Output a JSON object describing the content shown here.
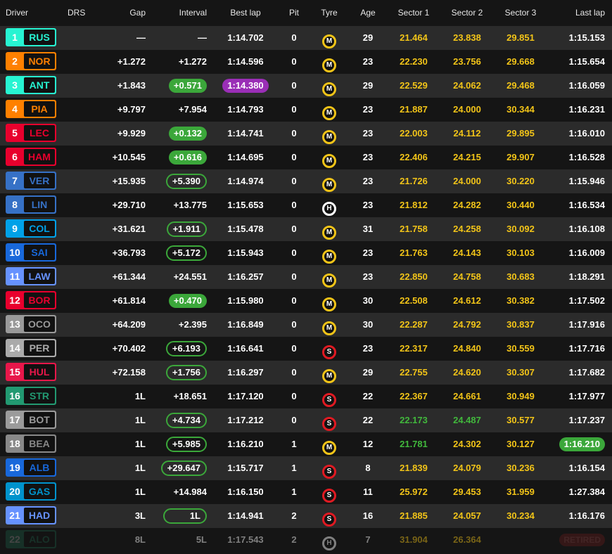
{
  "header": {
    "driver": "Driver",
    "drs": "DRS",
    "gap": "Gap",
    "interval": "Interval",
    "best": "Best lap",
    "pit": "Pit",
    "tyre": "Tyre",
    "age": "Age",
    "s1": "Sector 1",
    "s2": "Sector 2",
    "s3": "Sector 3",
    "last": "Last lap"
  },
  "rows": [
    {
      "pos": "1",
      "abbr": "RUS",
      "color": "#27f4d2",
      "gap": "—",
      "int": "—",
      "int_style": "plain",
      "best": "1:14.702",
      "best_style": "plain",
      "pit": "0",
      "tyre": "M",
      "age": "29",
      "s1": "21.464",
      "s1c": "yellow",
      "s2": "23.838",
      "s2c": "yellow",
      "s3": "29.851",
      "s3c": "yellow",
      "last": "1:15.153",
      "last_style": "plain"
    },
    {
      "pos": "2",
      "abbr": "NOR",
      "color": "#ff8000",
      "gap": "+1.272",
      "int": "+1.272",
      "int_style": "plain",
      "best": "1:14.596",
      "best_style": "plain",
      "pit": "0",
      "tyre": "M",
      "age": "23",
      "s1": "22.230",
      "s1c": "yellow",
      "s2": "23.756",
      "s2c": "yellow",
      "s3": "29.668",
      "s3c": "yellow",
      "last": "1:15.654",
      "last_style": "plain"
    },
    {
      "pos": "3",
      "abbr": "ANT",
      "color": "#27f4d2",
      "gap": "+1.843",
      "int": "+0.571",
      "int_style": "fill",
      "best": "1:14.380",
      "best_style": "purple",
      "pit": "0",
      "tyre": "M",
      "age": "29",
      "s1": "22.529",
      "s1c": "yellow",
      "s2": "24.062",
      "s2c": "yellow",
      "s3": "29.468",
      "s3c": "yellow",
      "last": "1:16.059",
      "last_style": "plain"
    },
    {
      "pos": "4",
      "abbr": "PIA",
      "color": "#ff8000",
      "gap": "+9.797",
      "int": "+7.954",
      "int_style": "plain",
      "best": "1:14.793",
      "best_style": "plain",
      "pit": "0",
      "tyre": "M",
      "age": "23",
      "s1": "21.887",
      "s1c": "yellow",
      "s2": "24.000",
      "s2c": "yellow",
      "s3": "30.344",
      "s3c": "yellow",
      "last": "1:16.231",
      "last_style": "plain"
    },
    {
      "pos": "5",
      "abbr": "LEC",
      "color": "#e8002d",
      "gap": "+9.929",
      "int": "+0.132",
      "int_style": "fill",
      "best": "1:14.741",
      "best_style": "plain",
      "pit": "0",
      "tyre": "M",
      "age": "23",
      "s1": "22.003",
      "s1c": "yellow",
      "s2": "24.112",
      "s2c": "yellow",
      "s3": "29.895",
      "s3c": "yellow",
      "last": "1:16.010",
      "last_style": "plain"
    },
    {
      "pos": "6",
      "abbr": "HAM",
      "color": "#e8002d",
      "gap": "+10.545",
      "int": "+0.616",
      "int_style": "fill",
      "best": "1:14.695",
      "best_style": "plain",
      "pit": "0",
      "tyre": "M",
      "age": "23",
      "s1": "22.406",
      "s1c": "yellow",
      "s2": "24.215",
      "s2c": "yellow",
      "s3": "29.907",
      "s3c": "yellow",
      "last": "1:16.528",
      "last_style": "plain"
    },
    {
      "pos": "7",
      "abbr": "VER",
      "color": "#3671c6",
      "gap": "+15.935",
      "int": "+5.390",
      "int_style": "outline",
      "best": "1:14.974",
      "best_style": "plain",
      "pit": "0",
      "tyre": "M",
      "age": "23",
      "s1": "21.726",
      "s1c": "yellow",
      "s2": "24.000",
      "s2c": "yellow",
      "s3": "30.220",
      "s3c": "yellow",
      "last": "1:15.946",
      "last_style": "plain"
    },
    {
      "pos": "8",
      "abbr": "LIN",
      "color": "#3671c6",
      "gap": "+29.710",
      "int": "+13.775",
      "int_style": "plain",
      "best": "1:15.653",
      "best_style": "plain",
      "pit": "0",
      "tyre": "H",
      "age": "23",
      "s1": "21.812",
      "s1c": "yellow",
      "s2": "24.282",
      "s2c": "yellow",
      "s3": "30.440",
      "s3c": "yellow",
      "last": "1:16.534",
      "last_style": "plain"
    },
    {
      "pos": "9",
      "abbr": "COL",
      "color": "#00a1e8",
      "gap": "+31.621",
      "int": "+1.911",
      "int_style": "outline",
      "best": "1:15.478",
      "best_style": "plain",
      "pit": "0",
      "tyre": "M",
      "age": "31",
      "s1": "21.758",
      "s1c": "yellow",
      "s2": "24.258",
      "s2c": "yellow",
      "s3": "30.092",
      "s3c": "yellow",
      "last": "1:16.108",
      "last_style": "plain"
    },
    {
      "pos": "10",
      "abbr": "SAI",
      "color": "#1868db",
      "gap": "+36.793",
      "int": "+5.172",
      "int_style": "outline",
      "best": "1:15.943",
      "best_style": "plain",
      "pit": "0",
      "tyre": "M",
      "age": "23",
      "s1": "21.763",
      "s1c": "yellow",
      "s2": "24.143",
      "s2c": "yellow",
      "s3": "30.103",
      "s3c": "yellow",
      "last": "1:16.009",
      "last_style": "plain"
    },
    {
      "pos": "11",
      "abbr": "LAW",
      "color": "#6692ff",
      "gap": "+61.344",
      "int": "+24.551",
      "int_style": "plain",
      "best": "1:16.257",
      "best_style": "plain",
      "pit": "0",
      "tyre": "M",
      "age": "23",
      "s1": "22.850",
      "s1c": "yellow",
      "s2": "24.758",
      "s2c": "yellow",
      "s3": "30.683",
      "s3c": "yellow",
      "last": "1:18.291",
      "last_style": "plain"
    },
    {
      "pos": "12",
      "abbr": "BOR",
      "color": "#e8002d",
      "gap": "+61.814",
      "int": "+0.470",
      "int_style": "fill",
      "best": "1:15.980",
      "best_style": "plain",
      "pit": "0",
      "tyre": "M",
      "age": "30",
      "s1": "22.508",
      "s1c": "yellow",
      "s2": "24.612",
      "s2c": "yellow",
      "s3": "30.382",
      "s3c": "yellow",
      "last": "1:17.502",
      "last_style": "plain"
    },
    {
      "pos": "13",
      "abbr": "OCO",
      "color": "#999999",
      "gap": "+64.209",
      "int": "+2.395",
      "int_style": "plain",
      "best": "1:16.849",
      "best_style": "plain",
      "pit": "0",
      "tyre": "M",
      "age": "30",
      "s1": "22.287",
      "s1c": "yellow",
      "s2": "24.792",
      "s2c": "yellow",
      "s3": "30.837",
      "s3c": "yellow",
      "last": "1:17.916",
      "last_style": "plain"
    },
    {
      "pos": "14",
      "abbr": "PER",
      "color": "#aaaaaa",
      "gap": "+70.402",
      "int": "+6.193",
      "int_style": "outline",
      "best": "1:16.641",
      "best_style": "plain",
      "pit": "0",
      "tyre": "S",
      "age": "23",
      "s1": "22.317",
      "s1c": "yellow",
      "s2": "24.840",
      "s2c": "yellow",
      "s3": "30.559",
      "s3c": "yellow",
      "last": "1:17.716",
      "last_style": "plain"
    },
    {
      "pos": "15",
      "abbr": "HUL",
      "color": "#e8174a",
      "gap": "+72.158",
      "int": "+1.756",
      "int_style": "outline",
      "best": "1:16.297",
      "best_style": "plain",
      "pit": "0",
      "tyre": "M",
      "age": "29",
      "s1": "22.755",
      "s1c": "yellow",
      "s2": "24.620",
      "s2c": "yellow",
      "s3": "30.307",
      "s3c": "yellow",
      "last": "1:17.682",
      "last_style": "plain"
    },
    {
      "pos": "16",
      "abbr": "STR",
      "color": "#229971",
      "gap": "1L",
      "int": "+18.651",
      "int_style": "plain",
      "best": "1:17.120",
      "best_style": "plain",
      "pit": "0",
      "tyre": "S",
      "age": "22",
      "s1": "22.367",
      "s1c": "yellow",
      "s2": "24.661",
      "s2c": "yellow",
      "s3": "30.949",
      "s3c": "yellow",
      "last": "1:17.977",
      "last_style": "plain"
    },
    {
      "pos": "17",
      "abbr": "BOT",
      "color": "#9b9b9b",
      "gap": "1L",
      "int": "+4.734",
      "int_style": "outline",
      "best": "1:17.212",
      "best_style": "plain",
      "pit": "0",
      "tyre": "S",
      "age": "22",
      "s1": "22.173",
      "s1c": "green",
      "s2": "24.487",
      "s2c": "green",
      "s3": "30.577",
      "s3c": "yellow",
      "last": "1:17.237",
      "last_style": "plain"
    },
    {
      "pos": "18",
      "abbr": "BEA",
      "color": "#888888",
      "gap": "1L",
      "int": "+5.985",
      "int_style": "outline",
      "best": "1:16.210",
      "best_style": "plain",
      "pit": "1",
      "tyre": "M",
      "age": "12",
      "s1": "21.781",
      "s1c": "green",
      "s2": "24.302",
      "s2c": "yellow",
      "s3": "30.127",
      "s3c": "yellow",
      "last": "1:16.210",
      "last_style": "fill"
    },
    {
      "pos": "19",
      "abbr": "ALB",
      "color": "#1868db",
      "gap": "1L",
      "int": "+29.647",
      "int_style": "outline",
      "best": "1:15.717",
      "best_style": "plain",
      "pit": "1",
      "tyre": "S",
      "age": "8",
      "s1": "21.839",
      "s1c": "yellow",
      "s2": "24.079",
      "s2c": "yellow",
      "s3": "30.236",
      "s3c": "yellow",
      "last": "1:16.154",
      "last_style": "plain"
    },
    {
      "pos": "20",
      "abbr": "GAS",
      "color": "#0093cc",
      "gap": "1L",
      "int": "+14.984",
      "int_style": "plain",
      "best": "1:16.150",
      "best_style": "plain",
      "pit": "1",
      "tyre": "S",
      "age": "11",
      "s1": "25.972",
      "s1c": "yellow",
      "s2": "29.453",
      "s2c": "yellow",
      "s3": "31.959",
      "s3c": "yellow",
      "last": "1:27.384",
      "last_style": "plain"
    },
    {
      "pos": "21",
      "abbr": "HAD",
      "color": "#6692ff",
      "gap": "3L",
      "int": "1L",
      "int_style": "outline-wide",
      "best": "1:14.941",
      "best_style": "plain",
      "pit": "2",
      "tyre": "S",
      "age": "16",
      "s1": "21.885",
      "s1c": "yellow",
      "s2": "24.057",
      "s2c": "yellow",
      "s3": "30.234",
      "s3c": "yellow",
      "last": "1:16.176",
      "last_style": "plain"
    },
    {
      "pos": "22",
      "abbr": "ALO",
      "color": "#229971",
      "gap": "8L",
      "int": "5L",
      "int_style": "plain",
      "best": "1:17.543",
      "best_style": "plain",
      "pit": "2",
      "tyre": "H",
      "age": "7",
      "s1": "31.904",
      "s1c": "yellow",
      "s2": "26.364",
      "s2c": "yellow",
      "s3": "",
      "s3c": "yellow",
      "last": "RETIRED",
      "last_style": "retired",
      "faded": true
    }
  ]
}
